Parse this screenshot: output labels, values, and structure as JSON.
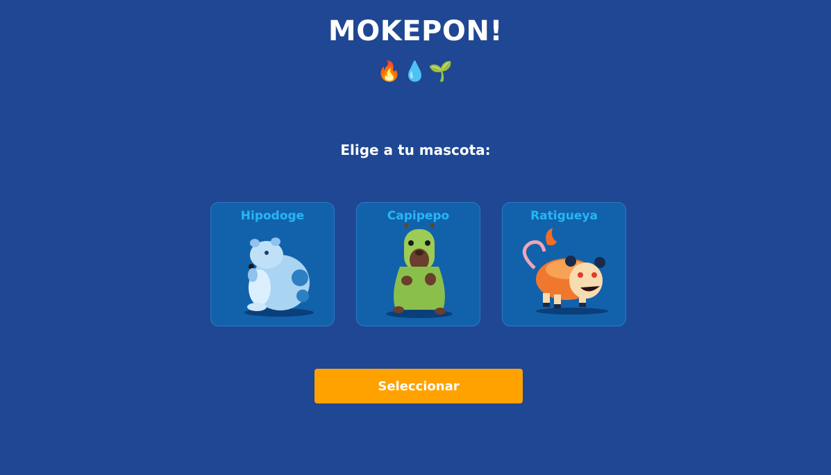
{
  "header": {
    "title": "MOKEPON!",
    "elements": [
      {
        "icon": "fire-icon",
        "glyph": "🔥"
      },
      {
        "icon": "water-drop-icon",
        "glyph": "💧"
      },
      {
        "icon": "seedling-icon",
        "glyph": "🌱"
      }
    ]
  },
  "selection": {
    "prompt": "Elige a tu mascota:",
    "pets": [
      {
        "name": "Hipodoge",
        "color": "#8fc2ec"
      },
      {
        "name": "Capipepo",
        "color": "#8bbf4c"
      },
      {
        "name": "Ratigueya",
        "color": "#f0782e"
      }
    ],
    "button_label": "Seleccionar"
  },
  "colors": {
    "background": "#1f4793",
    "card": "#1262ab",
    "card_title": "#27b6f3",
    "button": "#ffa200"
  }
}
